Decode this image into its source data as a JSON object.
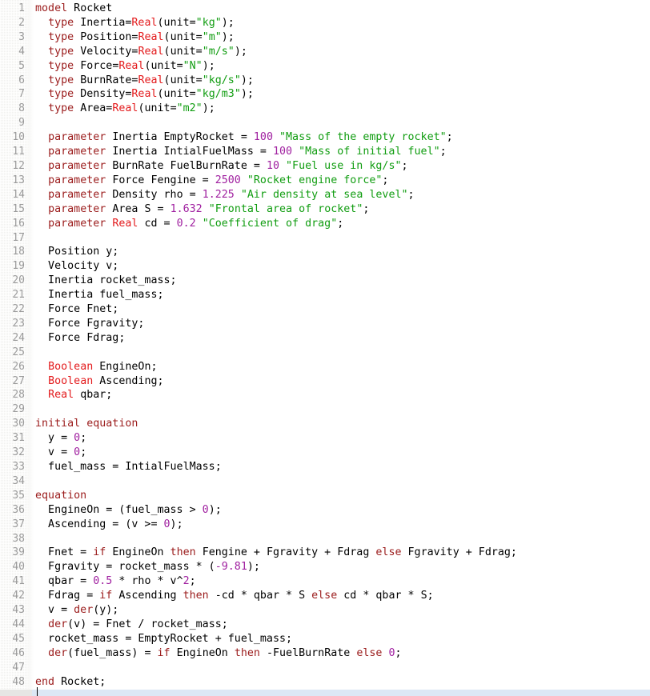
{
  "editor": {
    "language": "Modelica",
    "model_name": "Rocket",
    "first_line": 1,
    "last_line": 48,
    "cursor_line": 49,
    "colors": {
      "background": "#ffffff",
      "gutter_background": "#f0f0ee",
      "line_number": "#9a9a9a",
      "keyword": "#9b1c1c",
      "builtin_type": "#e31a1c",
      "string": "#119d11",
      "number": "#a020a0",
      "plain_text": "#000000",
      "current_line_highlight": "#dce8f5"
    }
  },
  "lines": [
    {
      "n": "1",
      "tokens": [
        {
          "t": "model",
          "c": "kw"
        },
        {
          "t": " Rocket",
          "c": "pl"
        }
      ]
    },
    {
      "n": "2",
      "tokens": [
        {
          "t": "  ",
          "c": "pl"
        },
        {
          "t": "type",
          "c": "kw"
        },
        {
          "t": " Inertia=",
          "c": "pl"
        },
        {
          "t": "Real",
          "c": "typ"
        },
        {
          "t": "(unit=",
          "c": "pl"
        },
        {
          "t": "\"kg\"",
          "c": "str"
        },
        {
          "t": ");",
          "c": "pl"
        }
      ]
    },
    {
      "n": "3",
      "tokens": [
        {
          "t": "  ",
          "c": "pl"
        },
        {
          "t": "type",
          "c": "kw"
        },
        {
          "t": " Position=",
          "c": "pl"
        },
        {
          "t": "Real",
          "c": "typ"
        },
        {
          "t": "(unit=",
          "c": "pl"
        },
        {
          "t": "\"m\"",
          "c": "str"
        },
        {
          "t": ");",
          "c": "pl"
        }
      ]
    },
    {
      "n": "4",
      "tokens": [
        {
          "t": "  ",
          "c": "pl"
        },
        {
          "t": "type",
          "c": "kw"
        },
        {
          "t": " Velocity=",
          "c": "pl"
        },
        {
          "t": "Real",
          "c": "typ"
        },
        {
          "t": "(unit=",
          "c": "pl"
        },
        {
          "t": "\"m/s\"",
          "c": "str"
        },
        {
          "t": ");",
          "c": "pl"
        }
      ]
    },
    {
      "n": "5",
      "tokens": [
        {
          "t": "  ",
          "c": "pl"
        },
        {
          "t": "type",
          "c": "kw"
        },
        {
          "t": " Force=",
          "c": "pl"
        },
        {
          "t": "Real",
          "c": "typ"
        },
        {
          "t": "(unit=",
          "c": "pl"
        },
        {
          "t": "\"N\"",
          "c": "str"
        },
        {
          "t": ");",
          "c": "pl"
        }
      ]
    },
    {
      "n": "6",
      "tokens": [
        {
          "t": "  ",
          "c": "pl"
        },
        {
          "t": "type",
          "c": "kw"
        },
        {
          "t": " BurnRate=",
          "c": "pl"
        },
        {
          "t": "Real",
          "c": "typ"
        },
        {
          "t": "(unit=",
          "c": "pl"
        },
        {
          "t": "\"kg/s\"",
          "c": "str"
        },
        {
          "t": ");",
          "c": "pl"
        }
      ]
    },
    {
      "n": "7",
      "tokens": [
        {
          "t": "  ",
          "c": "pl"
        },
        {
          "t": "type",
          "c": "kw"
        },
        {
          "t": " Density=",
          "c": "pl"
        },
        {
          "t": "Real",
          "c": "typ"
        },
        {
          "t": "(unit=",
          "c": "pl"
        },
        {
          "t": "\"kg/m3\"",
          "c": "str"
        },
        {
          "t": ");",
          "c": "pl"
        }
      ]
    },
    {
      "n": "8",
      "tokens": [
        {
          "t": "  ",
          "c": "pl"
        },
        {
          "t": "type",
          "c": "kw"
        },
        {
          "t": " Area=",
          "c": "pl"
        },
        {
          "t": "Real",
          "c": "typ"
        },
        {
          "t": "(unit=",
          "c": "pl"
        },
        {
          "t": "\"m2\"",
          "c": "str"
        },
        {
          "t": ");",
          "c": "pl"
        }
      ]
    },
    {
      "n": "9",
      "tokens": []
    },
    {
      "n": "10",
      "tokens": [
        {
          "t": "  ",
          "c": "pl"
        },
        {
          "t": "parameter",
          "c": "kw"
        },
        {
          "t": " Inertia EmptyRocket = ",
          "c": "pl"
        },
        {
          "t": "100",
          "c": "num"
        },
        {
          "t": " ",
          "c": "pl"
        },
        {
          "t": "\"Mass of the empty rocket\"",
          "c": "str"
        },
        {
          "t": ";",
          "c": "pl"
        }
      ]
    },
    {
      "n": "11",
      "tokens": [
        {
          "t": "  ",
          "c": "pl"
        },
        {
          "t": "parameter",
          "c": "kw"
        },
        {
          "t": " Inertia IntialFuelMass = ",
          "c": "pl"
        },
        {
          "t": "100",
          "c": "num"
        },
        {
          "t": " ",
          "c": "pl"
        },
        {
          "t": "\"Mass of initial fuel\"",
          "c": "str"
        },
        {
          "t": ";",
          "c": "pl"
        }
      ]
    },
    {
      "n": "12",
      "tokens": [
        {
          "t": "  ",
          "c": "pl"
        },
        {
          "t": "parameter",
          "c": "kw"
        },
        {
          "t": " BurnRate FuelBurnRate = ",
          "c": "pl"
        },
        {
          "t": "10",
          "c": "num"
        },
        {
          "t": " ",
          "c": "pl"
        },
        {
          "t": "\"Fuel use in kg/s\"",
          "c": "str"
        },
        {
          "t": ";",
          "c": "pl"
        }
      ]
    },
    {
      "n": "13",
      "tokens": [
        {
          "t": "  ",
          "c": "pl"
        },
        {
          "t": "parameter",
          "c": "kw"
        },
        {
          "t": " Force Fengine = ",
          "c": "pl"
        },
        {
          "t": "2500",
          "c": "num"
        },
        {
          "t": " ",
          "c": "pl"
        },
        {
          "t": "\"Rocket engine force\"",
          "c": "str"
        },
        {
          "t": ";",
          "c": "pl"
        }
      ]
    },
    {
      "n": "14",
      "tokens": [
        {
          "t": "  ",
          "c": "pl"
        },
        {
          "t": "parameter",
          "c": "kw"
        },
        {
          "t": " Density rho = ",
          "c": "pl"
        },
        {
          "t": "1.225",
          "c": "num"
        },
        {
          "t": " ",
          "c": "pl"
        },
        {
          "t": "\"Air density at sea level\"",
          "c": "str"
        },
        {
          "t": ";",
          "c": "pl"
        }
      ]
    },
    {
      "n": "15",
      "tokens": [
        {
          "t": "  ",
          "c": "pl"
        },
        {
          "t": "parameter",
          "c": "kw"
        },
        {
          "t": " Area S = ",
          "c": "pl"
        },
        {
          "t": "1.632",
          "c": "num"
        },
        {
          "t": " ",
          "c": "pl"
        },
        {
          "t": "\"Frontal area of rocket\"",
          "c": "str"
        },
        {
          "t": ";",
          "c": "pl"
        }
      ]
    },
    {
      "n": "16",
      "tokens": [
        {
          "t": "  ",
          "c": "pl"
        },
        {
          "t": "parameter",
          "c": "kw"
        },
        {
          "t": " ",
          "c": "pl"
        },
        {
          "t": "Real",
          "c": "typ"
        },
        {
          "t": " cd = ",
          "c": "pl"
        },
        {
          "t": "0.2",
          "c": "num"
        },
        {
          "t": " ",
          "c": "pl"
        },
        {
          "t": "\"Coefficient of drag\"",
          "c": "str"
        },
        {
          "t": ";",
          "c": "pl"
        }
      ]
    },
    {
      "n": "17",
      "tokens": []
    },
    {
      "n": "18",
      "tokens": [
        {
          "t": "  Position y;",
          "c": "pl"
        }
      ]
    },
    {
      "n": "19",
      "tokens": [
        {
          "t": "  Velocity v;",
          "c": "pl"
        }
      ]
    },
    {
      "n": "20",
      "tokens": [
        {
          "t": "  Inertia rocket_mass;",
          "c": "pl"
        }
      ]
    },
    {
      "n": "21",
      "tokens": [
        {
          "t": "  Inertia fuel_mass;",
          "c": "pl"
        }
      ]
    },
    {
      "n": "22",
      "tokens": [
        {
          "t": "  Force Fnet;",
          "c": "pl"
        }
      ]
    },
    {
      "n": "23",
      "tokens": [
        {
          "t": "  Force Fgravity;",
          "c": "pl"
        }
      ]
    },
    {
      "n": "24",
      "tokens": [
        {
          "t": "  Force Fdrag;",
          "c": "pl"
        }
      ]
    },
    {
      "n": "25",
      "tokens": []
    },
    {
      "n": "26",
      "tokens": [
        {
          "t": "  ",
          "c": "pl"
        },
        {
          "t": "Boolean",
          "c": "typ"
        },
        {
          "t": " EngineOn;",
          "c": "pl"
        }
      ]
    },
    {
      "n": "27",
      "tokens": [
        {
          "t": "  ",
          "c": "pl"
        },
        {
          "t": "Boolean",
          "c": "typ"
        },
        {
          "t": " Ascending;",
          "c": "pl"
        }
      ]
    },
    {
      "n": "28",
      "tokens": [
        {
          "t": "  ",
          "c": "pl"
        },
        {
          "t": "Real",
          "c": "typ"
        },
        {
          "t": " qbar;",
          "c": "pl"
        }
      ]
    },
    {
      "n": "29",
      "tokens": []
    },
    {
      "n": "30",
      "tokens": [
        {
          "t": "initial equation",
          "c": "kw"
        }
      ]
    },
    {
      "n": "31",
      "tokens": [
        {
          "t": "  y = ",
          "c": "pl"
        },
        {
          "t": "0",
          "c": "num"
        },
        {
          "t": ";",
          "c": "pl"
        }
      ]
    },
    {
      "n": "32",
      "tokens": [
        {
          "t": "  v = ",
          "c": "pl"
        },
        {
          "t": "0",
          "c": "num"
        },
        {
          "t": ";",
          "c": "pl"
        }
      ]
    },
    {
      "n": "33",
      "tokens": [
        {
          "t": "  fuel_mass = IntialFuelMass;",
          "c": "pl"
        }
      ]
    },
    {
      "n": "34",
      "tokens": []
    },
    {
      "n": "35",
      "tokens": [
        {
          "t": "equation",
          "c": "kw"
        }
      ]
    },
    {
      "n": "36",
      "tokens": [
        {
          "t": "  EngineOn = (fuel_mass > ",
          "c": "pl"
        },
        {
          "t": "0",
          "c": "num"
        },
        {
          "t": ");",
          "c": "pl"
        }
      ]
    },
    {
      "n": "37",
      "tokens": [
        {
          "t": "  Ascending = (v >= ",
          "c": "pl"
        },
        {
          "t": "0",
          "c": "num"
        },
        {
          "t": ");",
          "c": "pl"
        }
      ]
    },
    {
      "n": "38",
      "tokens": []
    },
    {
      "n": "39",
      "tokens": [
        {
          "t": "  Fnet = ",
          "c": "pl"
        },
        {
          "t": "if",
          "c": "kw"
        },
        {
          "t": " EngineOn ",
          "c": "pl"
        },
        {
          "t": "then",
          "c": "kw"
        },
        {
          "t": " Fengine + Fgravity + Fdrag ",
          "c": "pl"
        },
        {
          "t": "else",
          "c": "kw"
        },
        {
          "t": " Fgravity + Fdrag;",
          "c": "pl"
        }
      ]
    },
    {
      "n": "40",
      "tokens": [
        {
          "t": "  Fgravity = rocket_mass * (",
          "c": "pl"
        },
        {
          "t": "-9.81",
          "c": "num"
        },
        {
          "t": ");",
          "c": "pl"
        }
      ]
    },
    {
      "n": "41",
      "tokens": [
        {
          "t": "  qbar = ",
          "c": "pl"
        },
        {
          "t": "0.5",
          "c": "num"
        },
        {
          "t": " * rho * v^",
          "c": "pl"
        },
        {
          "t": "2",
          "c": "num"
        },
        {
          "t": ";",
          "c": "pl"
        }
      ]
    },
    {
      "n": "42",
      "tokens": [
        {
          "t": "  Fdrag = ",
          "c": "pl"
        },
        {
          "t": "if",
          "c": "kw"
        },
        {
          "t": " Ascending ",
          "c": "pl"
        },
        {
          "t": "then",
          "c": "kw"
        },
        {
          "t": " -cd * qbar * S ",
          "c": "pl"
        },
        {
          "t": "else",
          "c": "kw"
        },
        {
          "t": " cd * qbar * S;",
          "c": "pl"
        }
      ]
    },
    {
      "n": "43",
      "tokens": [
        {
          "t": "  v = ",
          "c": "pl"
        },
        {
          "t": "der",
          "c": "kw"
        },
        {
          "t": "(y);",
          "c": "pl"
        }
      ]
    },
    {
      "n": "44",
      "tokens": [
        {
          "t": "  ",
          "c": "pl"
        },
        {
          "t": "der",
          "c": "kw"
        },
        {
          "t": "(v) = Fnet / rocket_mass;",
          "c": "pl"
        }
      ]
    },
    {
      "n": "45",
      "tokens": [
        {
          "t": "  rocket_mass = EmptyRocket + fuel_mass;",
          "c": "pl"
        }
      ]
    },
    {
      "n": "46",
      "tokens": [
        {
          "t": "  ",
          "c": "pl"
        },
        {
          "t": "der",
          "c": "kw"
        },
        {
          "t": "(fuel_mass) = ",
          "c": "pl"
        },
        {
          "t": "if",
          "c": "kw"
        },
        {
          "t": " EngineOn ",
          "c": "pl"
        },
        {
          "t": "then",
          "c": "kw"
        },
        {
          "t": " -FuelBurnRate ",
          "c": "pl"
        },
        {
          "t": "else",
          "c": "kw"
        },
        {
          "t": " ",
          "c": "pl"
        },
        {
          "t": "0",
          "c": "num"
        },
        {
          "t": ";",
          "c": "pl"
        }
      ]
    },
    {
      "n": "47",
      "tokens": []
    },
    {
      "n": "48",
      "tokens": [
        {
          "t": "end",
          "c": "kw"
        },
        {
          "t": " Rocket;",
          "c": "pl"
        }
      ]
    }
  ]
}
